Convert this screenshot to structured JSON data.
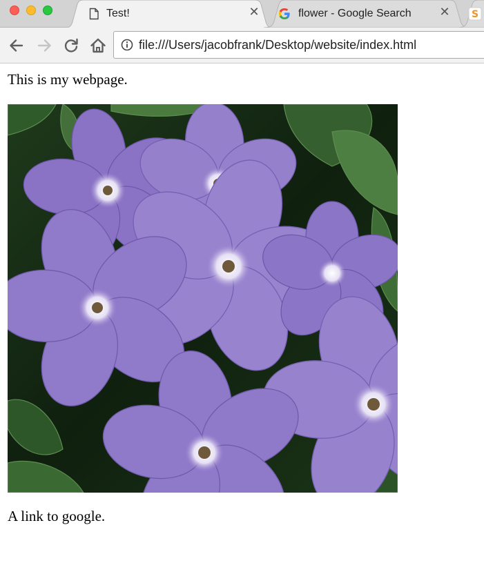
{
  "window": {
    "traffic_lights": [
      "close",
      "minimize",
      "maximize"
    ]
  },
  "tabs": [
    {
      "title": "Test!",
      "icon": "document-icon",
      "active": true
    },
    {
      "title": "flower - Google Search",
      "icon": "google-g-icon",
      "active": false
    },
    {
      "title": "",
      "icon": "sublime-s-icon",
      "active": false
    }
  ],
  "toolbar": {
    "back_icon": "back-arrow-icon",
    "forward_icon": "forward-arrow-icon",
    "reload_icon": "reload-icon",
    "home_icon": "home-icon",
    "info_icon": "info-icon",
    "url": "file:///Users/jacobfrank/Desktop/website/index.html"
  },
  "page": {
    "intro_text": "This is my webpage.",
    "image_subject": "purple flowers photo",
    "link_text": "A link to google."
  },
  "colors": {
    "petal": "#8e78c6",
    "leaf": "#2f5a2a",
    "tabstrip": "#d3d3d3",
    "toolbar": "#f2f2f2"
  }
}
